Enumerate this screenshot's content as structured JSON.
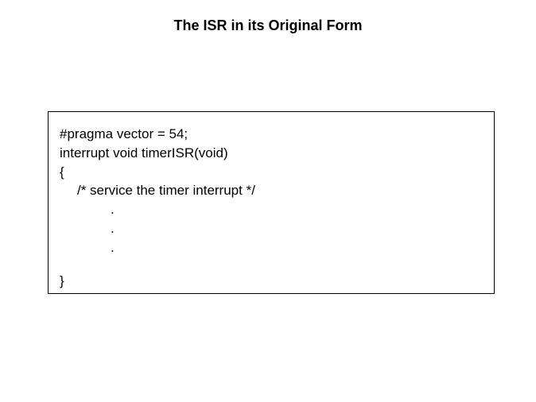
{
  "title": "The ISR in its Original Form",
  "code": {
    "line1": "#pragma vector = 54;",
    "line2": "interrupt void timerISR(void)",
    "line3": "{",
    "line4": "/* service the timer interrupt */",
    "line5": ".",
    "line6": ".",
    "line7": ".",
    "line8": "}"
  }
}
